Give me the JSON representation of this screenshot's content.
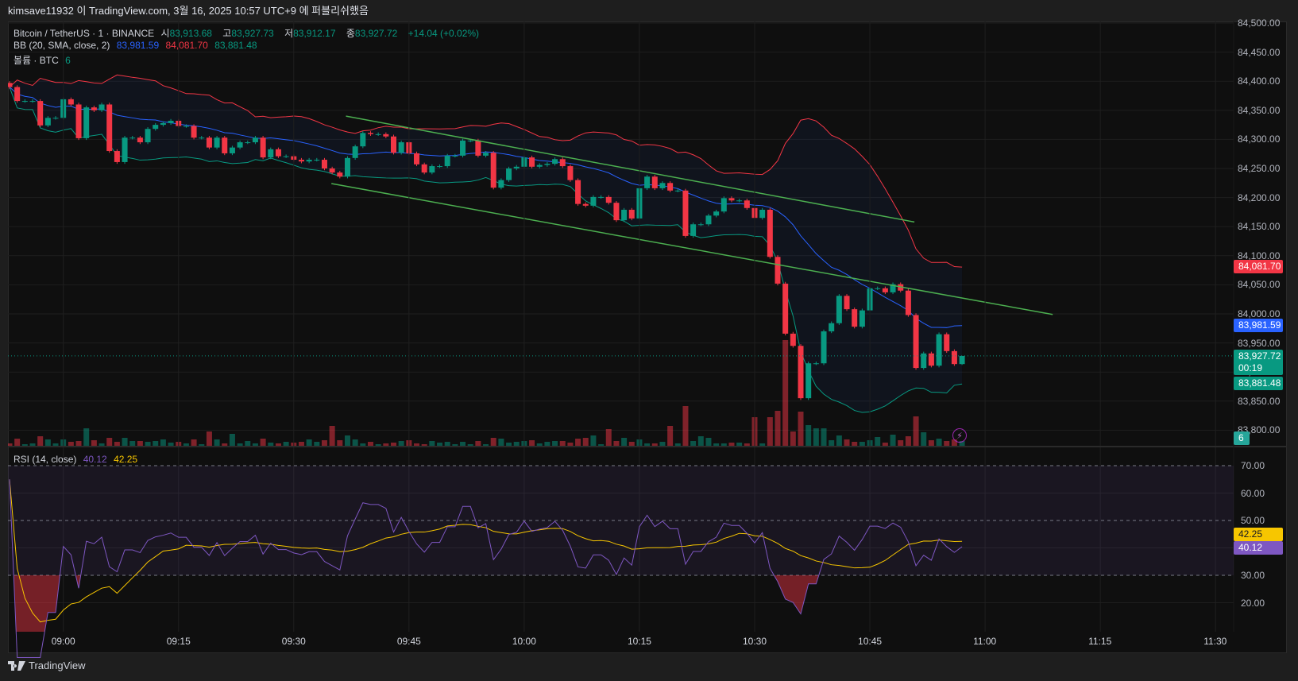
{
  "title_bar": "kimsave11932 이 TradingView.com, 3월 16, 2025 10:57 UTC+9 에 퍼블리쉬했음",
  "legend": {
    "symbol": "Bitcoin / TetherUS · 1 · BINANCE",
    "open_label": "시",
    "open": "83,913.68",
    "high_label": "고",
    "high": "83,927.73",
    "low_label": "저",
    "low": "83,912.17",
    "close_label": "종",
    "close": "83,927.72",
    "change": "+14.04 (+0.02%)",
    "bb_label": "BB (20, SMA, close, 2)",
    "bb_basis": "83,981.59",
    "bb_upper": "84,081.70",
    "bb_lower": "83,881.48",
    "volume_label": "볼륨 · BTC",
    "volume": "6",
    "rsi_label": "RSI (14, close)",
    "rsi_value": "40.12",
    "rsi_ma": "42.25"
  },
  "badges": {
    "bb_upper": "84,081.70",
    "bb_basis": "83,981.59",
    "last_price": "83,927.72",
    "countdown": "00:19",
    "bb_lower": "83,881.48",
    "volume": "6",
    "rsi_ma": "42.25",
    "rsi": "40.12"
  },
  "footer": {
    "brand": "TradingView"
  },
  "colors": {
    "up": "#089981",
    "down": "#f23645",
    "bb_basis": "#2962ff",
    "bb_upper": "#f23645",
    "bb_lower": "#089981",
    "trendline": "#4caf50",
    "rsi": "#7e57c2",
    "rsi_ma": "#f7c600"
  },
  "chart_data": {
    "type": "candlestick",
    "interval": "1m",
    "start_time": "08:53",
    "end_time": "10:57",
    "close": [
      84390,
      84366,
      84366,
      84366,
      84324,
      84337,
      84337,
      84369,
      84360,
      84302,
      84355,
      84350,
      84360,
      84280,
      84261,
      84303,
      84303,
      84295,
      84318,
      84325,
      84328,
      84332,
      84323,
      84323,
      84303,
      84303,
      84286,
      84303,
      84276,
      84286,
      84295,
      84295,
      84303,
      84269,
      84283,
      84271,
      84271,
      84265,
      84262,
      84265,
      84265,
      84250,
      84243,
      84236,
      84268,
      84288,
      84311,
      84309,
      84309,
      84305,
      84277,
      84295,
      84276,
      84257,
      84243,
      84254,
      84254,
      84272,
      84272,
      84298,
      84298,
      84272,
      84277,
      84217,
      84230,
      84250,
      84253,
      84269,
      84253,
      84256,
      84258,
      84266,
      84254,
      84230,
      84189,
      84186,
      84201,
      84201,
      84191,
      84161,
      84179,
      84164,
      84216,
      84236,
      84216,
      84225,
      84212,
      84212,
      84134,
      84154,
      84154,
      84169,
      84176,
      84199,
      84195,
      84195,
      84182,
      84165,
      84179,
      84098,
      84052,
      83966,
      83945,
      83855,
      83915,
      83915,
      83970,
      83984,
      84031,
      84008,
      83978,
      84006,
      84044,
      84044,
      84037,
      84051,
      84040,
      83998,
      83907,
      83932,
      83911,
      83965,
      83936,
      83913.68,
      83927.72
    ],
    "volume": [
      3,
      9,
      2,
      3,
      12,
      8,
      3,
      8,
      5,
      6,
      22,
      7,
      3,
      10,
      5,
      10,
      6,
      6,
      5,
      6,
      8,
      4,
      5,
      3,
      8,
      2,
      18,
      8,
      3,
      15,
      3,
      6,
      3,
      9,
      4,
      3,
      5,
      4,
      5,
      8,
      5,
      7,
      25,
      7,
      13,
      8,
      3,
      5,
      2,
      3,
      4,
      6,
      7,
      3,
      2,
      6,
      4,
      5,
      2,
      5,
      2,
      6,
      2,
      10,
      9,
      4,
      5,
      6,
      7,
      3,
      5,
      6,
      6,
      4,
      9,
      10,
      13,
      2,
      21,
      6,
      10,
      5,
      8,
      3,
      3,
      5,
      25,
      3,
      50,
      6,
      12,
      10,
      3,
      3,
      4,
      4,
      3,
      36,
      3,
      36,
      44,
      133,
      18,
      43,
      26,
      22,
      22,
      7,
      13,
      8,
      5,
      5,
      7,
      11,
      4,
      14,
      7,
      12,
      37,
      17,
      7,
      9,
      6,
      8,
      6
    ],
    "last_candle": {
      "open": 83913.68,
      "high": 83927.73,
      "low": 83912.17,
      "close": 83927.72
    },
    "trendlines": [
      {
        "from": {
          "time": "09:36.8",
          "price": 84340
        },
        "to": {
          "time": "10:50.8",
          "price": 84158
        }
      },
      {
        "from": {
          "time": "09:34.9",
          "price": 84224
        },
        "to": {
          "time": "11:08.8",
          "price": 83999
        }
      }
    ],
    "price_axis": {
      "range": [
        83800,
        84500
      ],
      "ticks": [
        "84,500.00",
        "84,450.00",
        "84,400.00",
        "84,350.00",
        "84,300.00",
        "84,250.00",
        "84,200.00",
        "84,150.00",
        "84,100.00",
        "84,050.00",
        "84,000.00",
        "83,950.00",
        "83,900.00",
        "83,850.00",
        "83,800.00"
      ]
    },
    "time_axis": {
      "ticks": [
        "09:00",
        "09:15",
        "09:30",
        "09:45",
        "10:00",
        "10:15",
        "10:30",
        "10:45",
        "11:00",
        "11:15",
        "11:30"
      ]
    },
    "rsi_axis": {
      "ticks": [
        "70.00",
        "60.00",
        "50.00",
        "30.00",
        "20.00"
      ],
      "upper_band": 70,
      "middle": 50,
      "lower_band": 30
    },
    "grid": true
  }
}
